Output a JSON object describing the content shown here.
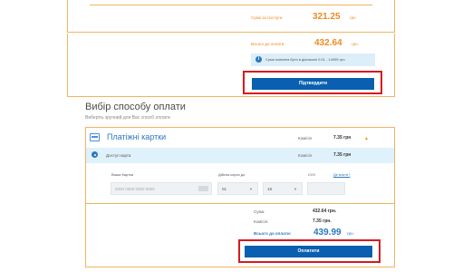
{
  "summary": {
    "fee_label": "Сума за послуги",
    "fee_value": "321.25",
    "fee_currency": "грн",
    "total_label": "Всього до оплати:",
    "total_value": "432.64",
    "total_currency": "грн.",
    "info_text": "Сума повинна бути в діапазоні 0.01 - 14999 грн",
    "confirm_button": "Підтвердити"
  },
  "payment": {
    "section_title": "Вибір способу оплати",
    "section_subtitle": "Виберіть зручний для Вас спосіб оплати",
    "method_title": "Платіжні картки",
    "commission_label": "Комісія",
    "commission_value": "7.35 грн",
    "row_label": "Доступ карта",
    "row_commission_label": "Комісія",
    "row_commission_value": "7.35 грн",
    "card_number_label": "Ваша Картка",
    "card_number_placeholder": "0000 0000 0000 0000",
    "valid_label": "Дійсна карта до",
    "month_value": "01",
    "year_value": "18",
    "cvv_label": "CVV",
    "cvv_help": "Де взяти?",
    "sum_label": "Сума:",
    "sum_value": "432.64 грн.",
    "comm_label": "Комісія:",
    "comm_value": "7.35 грн.",
    "grand_label": "Всього до оплати:",
    "grand_value": "439.99",
    "grand_currency": "грн.",
    "pay_button": "Оплатити"
  },
  "colors": {
    "accent_orange": "#f08a24",
    "primary_blue": "#0a5fb0",
    "highlight_red": "#d71920"
  },
  "icons": {
    "info": "info-icon",
    "cards": "credit-card-icon",
    "chevron": "chevron-up-icon"
  }
}
